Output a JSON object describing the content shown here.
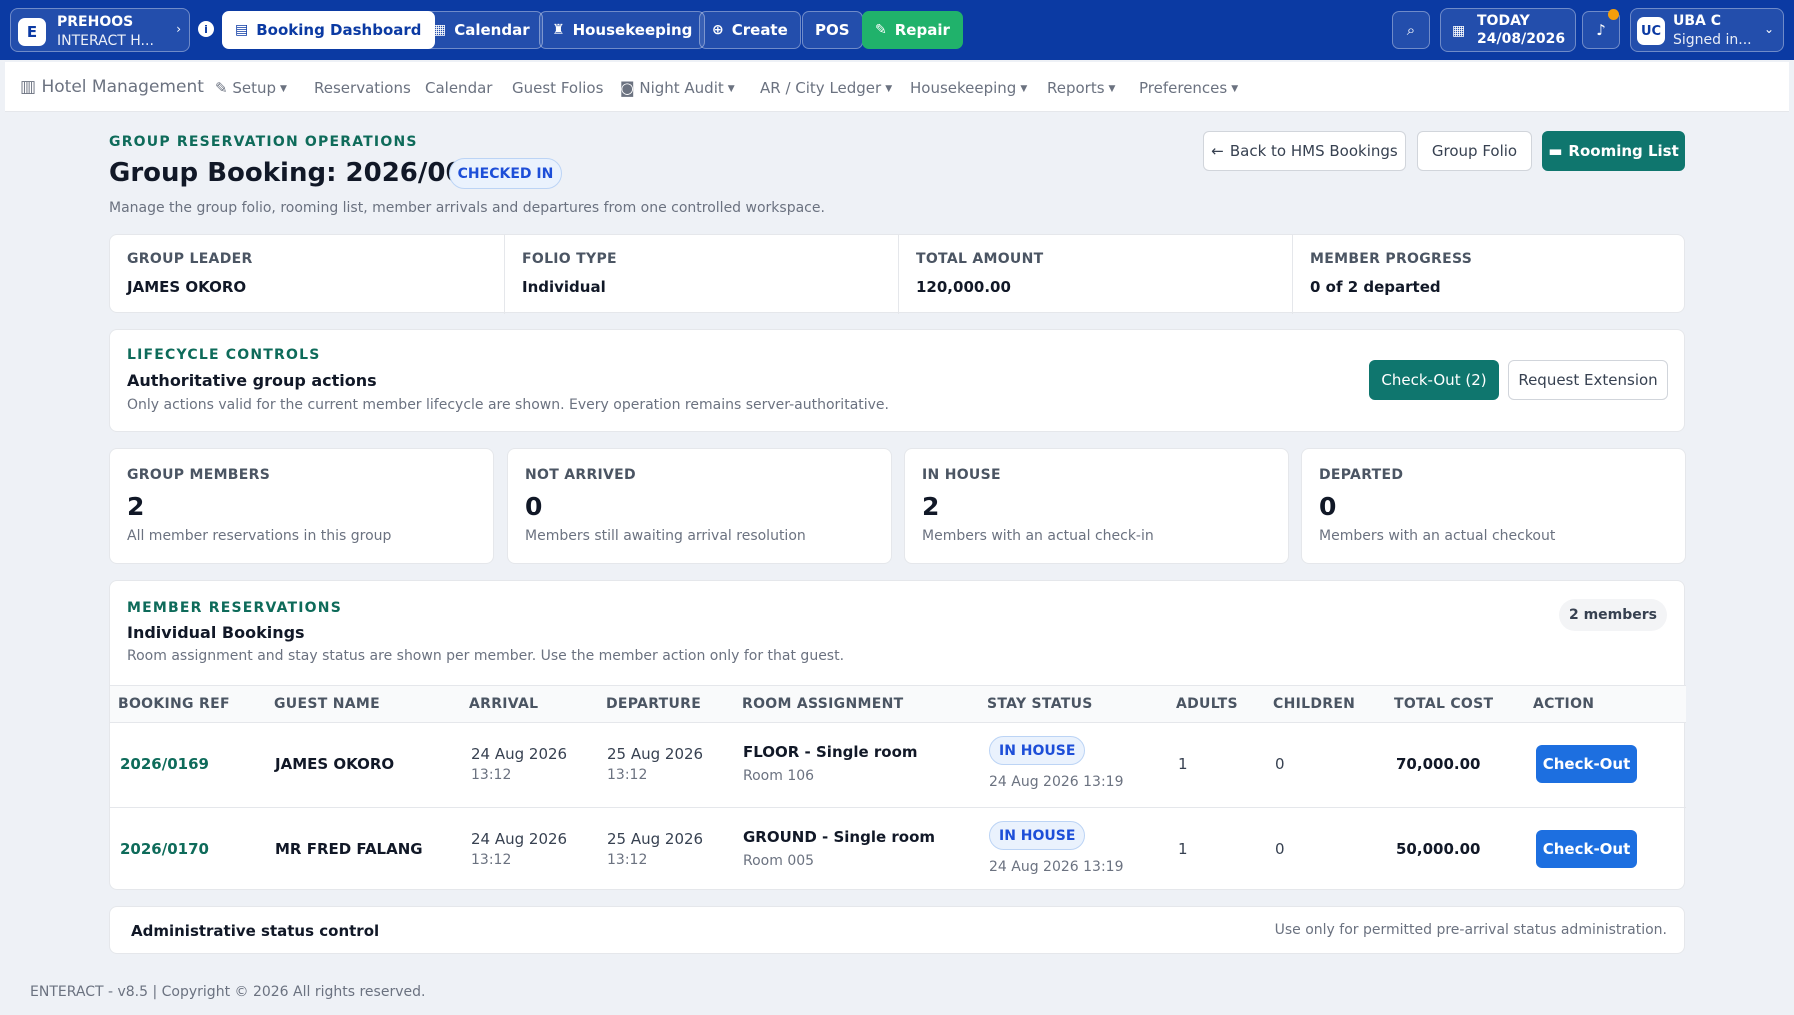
{
  "topbar": {
    "brand_logo": "E",
    "brand_name": "PREHOOS",
    "brand_sub": "INTERACT H...",
    "buttons": {
      "booking_dashboard": "Booking Dashboard",
      "calendar": "Calendar",
      "housekeeping": "Housekeeping",
      "create": "Create",
      "pos": "POS",
      "repair": "Repair"
    },
    "today_label": "TODAY",
    "today_date": "24/08/2026",
    "user_initials": "UC",
    "user_name": "UBA C",
    "user_status": "Signed in...",
    "icons": [
      "chevron-right-icon",
      "info-icon",
      "calendar-icon",
      "broom-icon",
      "plus-circle-icon",
      "wrench-icon",
      "search-icon",
      "bell-icon",
      "chevron-down-icon"
    ],
    "colors": {
      "bar": "#0b3aa3",
      "repair": "#20b26b",
      "notification": "#f59e0b"
    }
  },
  "subnav": {
    "brand": "Hotel Management",
    "items": {
      "setup": "Setup",
      "reservations": "Reservations",
      "calendar": "Calendar",
      "guest_folios": "Guest Folios",
      "night_audit": "Night Audit",
      "ar_city_ledger": "AR / City Ledger",
      "housekeeping": "Housekeeping",
      "reports": "Reports",
      "preferences": "Preferences"
    }
  },
  "header": {
    "eyebrow": "GROUP RESERVATION OPERATIONS",
    "title": "Group Booking: 2026/0035",
    "status_badge": "CHECKED IN",
    "description": "Manage the group folio, rooming list, member arrivals and departures from one controlled workspace.",
    "back_button": "Back to HMS Bookings",
    "group_folio_button": "Group Folio",
    "rooming_list_button": "Rooming List"
  },
  "summary": {
    "group_leader_label": "GROUP LEADER",
    "group_leader_value": "JAMES OKORO",
    "folio_type_label": "FOLIO TYPE",
    "folio_type_value": "Individual",
    "total_amount_label": "TOTAL AMOUNT",
    "total_amount_value": "120,000.00",
    "member_progress_label": "MEMBER PROGRESS",
    "member_progress_value": "0 of 2 departed"
  },
  "lifecycle": {
    "eyebrow": "LIFECYCLE CONTROLS",
    "title": "Authoritative group actions",
    "description": "Only actions valid for the current member lifecycle are shown. Every operation remains server-authoritative.",
    "checkout_button": "Check-Out (2)",
    "extension_button": "Request Extension"
  },
  "stats": {
    "group_members": {
      "label": "GROUP MEMBERS",
      "value": "2",
      "desc": "All member reservations in this group"
    },
    "not_arrived": {
      "label": "NOT ARRIVED",
      "value": "0",
      "desc": "Members still awaiting arrival resolution"
    },
    "in_house": {
      "label": "IN HOUSE",
      "value": "2",
      "desc": "Members with an actual check-in"
    },
    "departed": {
      "label": "DEPARTED",
      "value": "0",
      "desc": "Members with an actual checkout"
    }
  },
  "members": {
    "eyebrow": "MEMBER RESERVATIONS",
    "title": "Individual Bookings",
    "description": "Room assignment and stay status are shown per member. Use the member action only for that guest.",
    "count_badge": "2 members",
    "columns": {
      "booking_ref": "BOOKING REF",
      "guest_name": "GUEST NAME",
      "arrival": "ARRIVAL",
      "departure": "DEPARTURE",
      "room_assignment": "ROOM ASSIGNMENT",
      "stay_status": "STAY STATUS",
      "adults": "ADULTS",
      "children": "CHILDREN",
      "total_cost": "TOTAL COST",
      "action": "ACTION"
    },
    "rows": [
      {
        "ref": "2026/0169",
        "guest": "JAMES OKORO",
        "arrival_date": "24 Aug 2026",
        "arrival_time": "13:12",
        "departure_date": "25 Aug 2026",
        "departure_time": "13:12",
        "room_type": "FLOOR - Single room",
        "room_no": "Room 106",
        "status": "IN HOUSE",
        "status_time": "24 Aug 2026 13:19",
        "adults": "1",
        "children": "0",
        "total": "70,000.00",
        "action": "Check-Out"
      },
      {
        "ref": "2026/0170",
        "guest": "MR FRED FALANG",
        "arrival_date": "24 Aug 2026",
        "arrival_time": "13:12",
        "departure_date": "25 Aug 2026",
        "departure_time": "13:12",
        "room_type": "GROUND - Single room",
        "room_no": "Room 005",
        "status": "IN HOUSE",
        "status_time": "24 Aug 2026 13:19",
        "adults": "1",
        "children": "0",
        "total": "50,000.00",
        "action": "Check-Out"
      }
    ]
  },
  "admin": {
    "title": "Administrative status control",
    "note": "Use only for permitted pre-arrival status administration."
  },
  "footer": {
    "text": "ENTERACT - v8.5 | Copyright © 2026 All rights reserved."
  },
  "theme": {
    "accent_green": "#0f766e",
    "accent_blue": "#1d6fe0",
    "page_bg": "#eef1f6"
  }
}
